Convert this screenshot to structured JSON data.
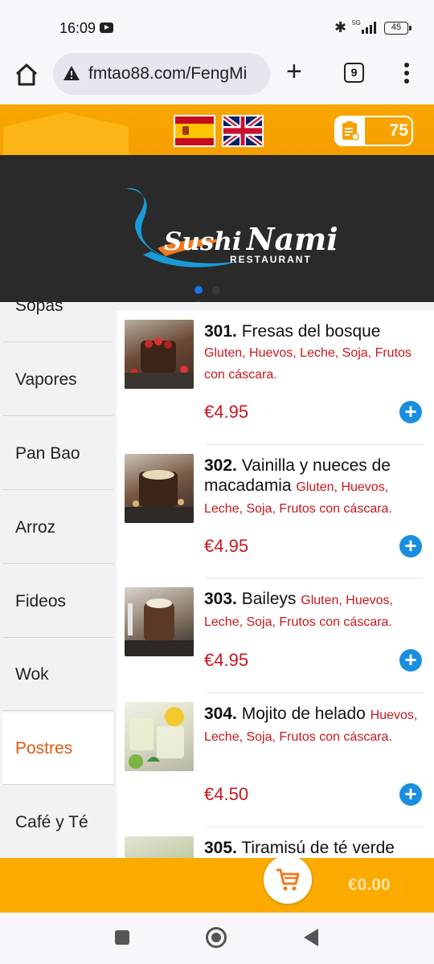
{
  "status_bar": {
    "time": "16:09",
    "network": "5G",
    "battery": "45"
  },
  "browser": {
    "url": "fmtao88.com/FengMi",
    "tab_count": "9"
  },
  "header": {
    "order_count": "75"
  },
  "banner": {
    "logo_word1": "Sushi",
    "logo_word2": "Nami",
    "logo_sub": "RESTAURANT"
  },
  "categories": [
    {
      "label": "Sopas"
    },
    {
      "label": "Vapores"
    },
    {
      "label": "Pan Bao"
    },
    {
      "label": "Arroz"
    },
    {
      "label": "Fideos"
    },
    {
      "label": "Wok"
    },
    {
      "label": "Postres"
    },
    {
      "label": "Café y Té"
    }
  ],
  "selected_category": "Postres",
  "products": [
    {
      "number": "301.",
      "name": "Fresas del bosque",
      "allergens": "Gluten, Huevos, Leche, Soja, Frutos con cáscara.",
      "price": "€4.95"
    },
    {
      "number": "302.",
      "name": "Vainilla y nueces de macadamia",
      "allergens": "Gluten, Huevos, Leche, Soja, Frutos con cáscara.",
      "price": "€4.95"
    },
    {
      "number": "303.",
      "name": "Baileys",
      "allergens": "Gluten, Huevos, Leche, Soja, Frutos con cáscara.",
      "price": "€4.95"
    },
    {
      "number": "304.",
      "name": "Mojito de helado",
      "allergens": "Huevos, Leche, Soja, Frutos con cáscara.",
      "price": "€4.50"
    },
    {
      "number": "305.",
      "name": "Tiramisú de té verde"
    }
  ],
  "cart": {
    "total": "€0.00"
  },
  "colors": {
    "brand_orange": "#fbab00",
    "price_red": "#c8161d",
    "add_blue": "#1a8fe0",
    "selected_category": "#e0580c"
  }
}
